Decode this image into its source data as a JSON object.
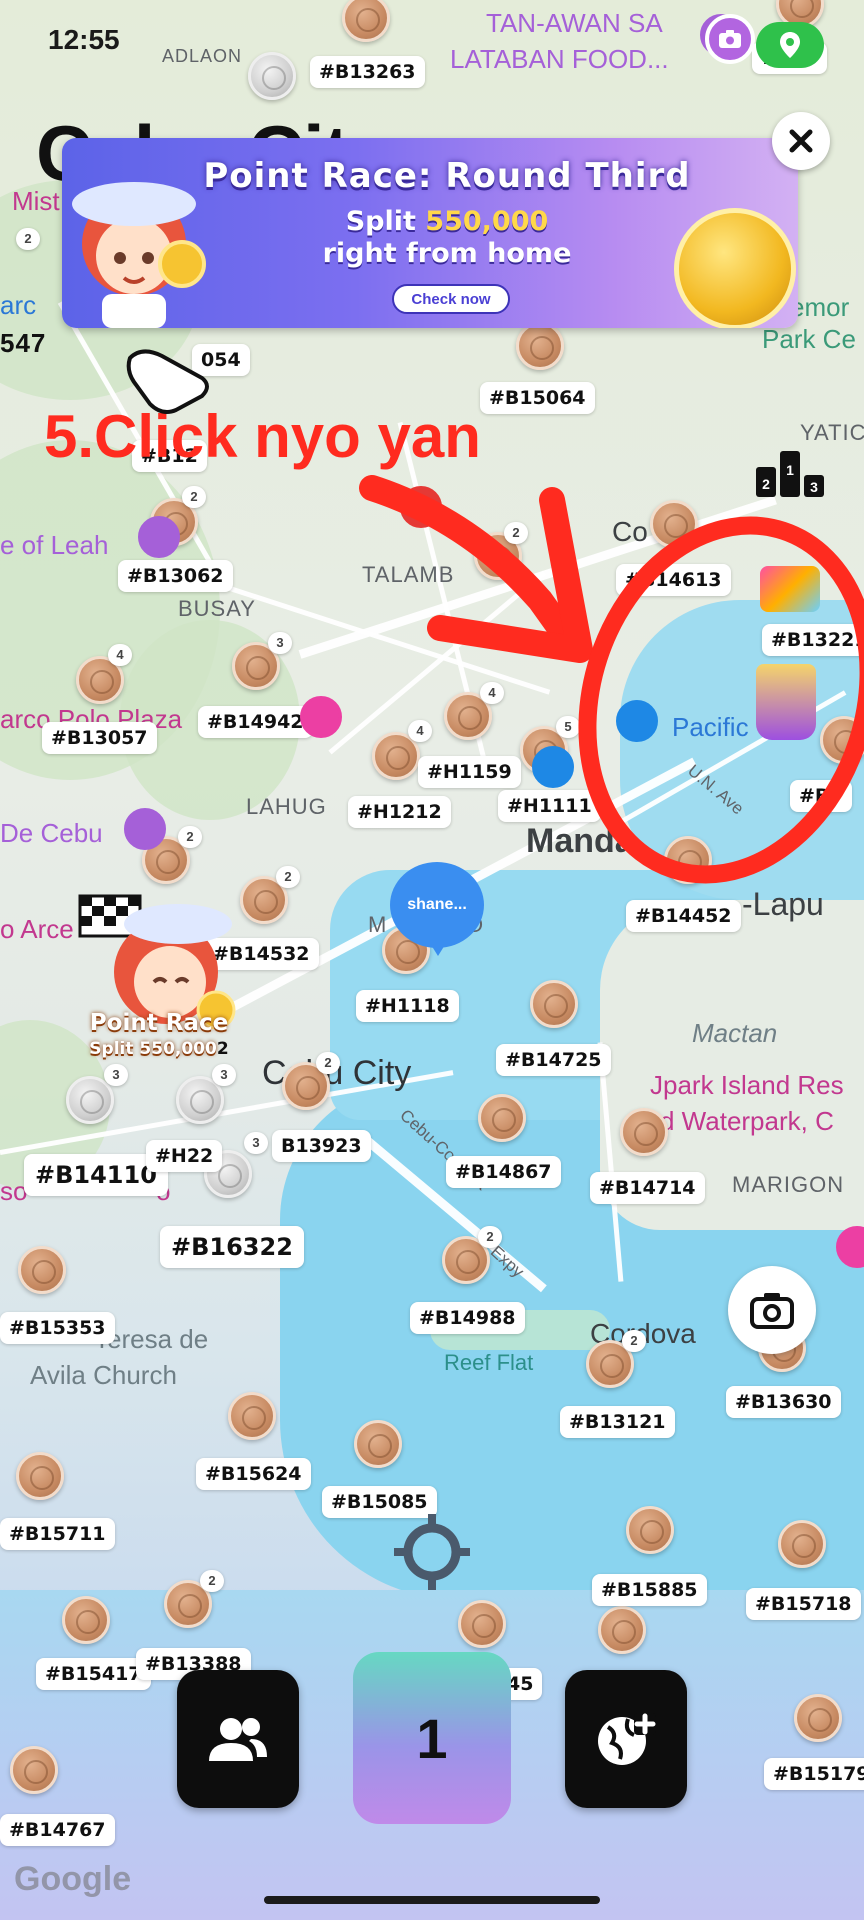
{
  "status_bar": {
    "time": "12:55",
    "extra": "..."
  },
  "city_title": "Cebu City",
  "banner": {
    "title": "Point Race: Round Third",
    "line1_prefix": "Split ",
    "line1_amount": "550,000",
    "line2": "right from home",
    "cta": "Check now"
  },
  "annotation": {
    "text": "5.Click nyo yan"
  },
  "places": {
    "adlaon": "ADLAON",
    "tan_awan": "TAN-AWAN SA",
    "lataban": "LATABAN FOOD...",
    "mist": "Mist",
    "yatic": "YATIC",
    "memor": "emor",
    "park_ce": "Park Ce",
    "leah": "e of Leah",
    "busay": "BUSAY",
    "talamban": "TALAMB",
    "consolacion": "Co",
    "marco_polo": "arco Polo Plaza",
    "lahug": "LAHUG",
    "pacific": "Pacific",
    "mandaue": "Manda",
    "de_cebu": "De Cebu",
    "lapu": "-Lapu",
    "un_ave": "U.N. Ave",
    "arce": "o Arce",
    "mandaue_m": "M",
    "mandaue_o": "O",
    "mactan": "Mactan",
    "cebu_city": "Cebu City",
    "jpark1": "Jpark Island Res",
    "jpark2": "d Waterpark, C",
    "marigon": "MARIGON",
    "cebu_cordova": "Cebu-Cordova",
    "expy": "Expy",
    "teresa1": "Teresa de",
    "teresa2": "Avila Church",
    "reef_flat": "Reef Flat",
    "cordova": "Cordova",
    "so": "so",
    "o_small": "o",
    "arc": "arc",
    "num547": "547"
  },
  "tags": {
    "b1385": "#B1385",
    "b13263": "#B13263",
    "b56": "#B56",
    "b054": "054",
    "b15064": "#B15064",
    "b12": "#B12",
    "b13062": "#B13062",
    "b14613": "#B14613",
    "b13221": "#B13221",
    "b14942": "#B14942",
    "b13057": "#B13057",
    "h1159": "#H1159",
    "h1212": "#H1212",
    "h1111": "#H1111",
    "b7": "#B7",
    "b14452": "#B14452",
    "b14532": "#B14532",
    "h1118": "#H1118",
    "b14725": "#B14725",
    "b14110": "#B14110",
    "h22": "#H22",
    "b13923": "B13923",
    "b14867": "#B14867",
    "b14714": "#B14714",
    "b16322": "#B16322",
    "b15353": "#B15353",
    "b14988": "#B14988",
    "b13630": "#B13630",
    "b13121": "#B13121",
    "b15624": "#B15624",
    "b15085": "#B15085",
    "b15711": "#B15711",
    "b15885": "#B15885",
    "b15718": "#B15718",
    "b15417": "#B15417",
    "b13388": "#B13388",
    "b45": "45",
    "b15179": "#B15179",
    "b14767": "#B14767"
  },
  "counts": {
    "c2": "2",
    "c3": "3",
    "c4": "4",
    "c5": "5"
  },
  "user_bubble": "shane...",
  "racer": {
    "line1": "Point Race",
    "line2": "Split 550,000",
    "suffix": "2"
  },
  "dock": {
    "center_value": "1"
  },
  "watermark": "Google",
  "icons": {
    "close": "close-icon",
    "friends": "friends-icon",
    "globe_add": "globe-add-icon",
    "camera": "camera-icon",
    "locate": "crosshair-icon",
    "location_pin": "location-pin-icon",
    "ranking": "ranking-icon"
  },
  "colors": {
    "annotation": "#ff2b1f",
    "map_water": "#8ad4ef",
    "banner": "#6a66ec",
    "dock": "#0d0d0d"
  }
}
